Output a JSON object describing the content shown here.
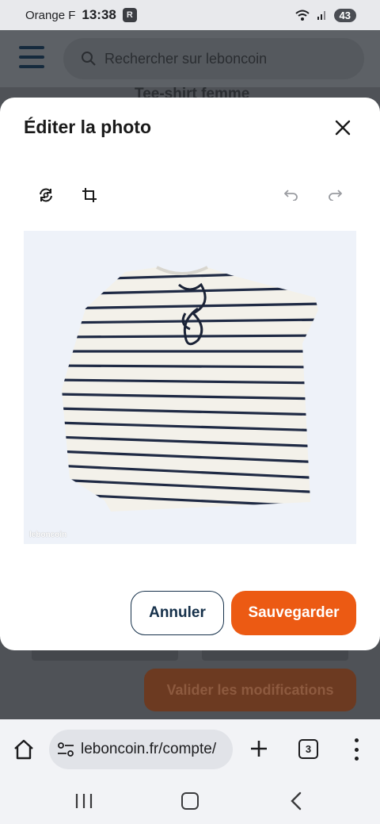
{
  "status_bar": {
    "carrier": "Orange F",
    "time": "13:38",
    "app_icon": "R",
    "battery": "43"
  },
  "background_page": {
    "search_placeholder": "Rechercher sur leboncoin",
    "ad_title": "Tee-shirt femme",
    "validate_label": "Valider les modifications"
  },
  "modal": {
    "title": "Éditer la photo",
    "tools": [
      "rotate-icon",
      "crop-icon",
      "undo-icon",
      "redo-icon"
    ],
    "photo_watermark": "leboncoin",
    "cancel_label": "Annuler",
    "save_label": "Sauvegarder"
  },
  "browser": {
    "url": "leboncoin.fr/compte/",
    "tab_count": "3"
  },
  "colors": {
    "primary": "#ec5a13",
    "navy": "#15304a",
    "stripe": "#1f2a44"
  }
}
